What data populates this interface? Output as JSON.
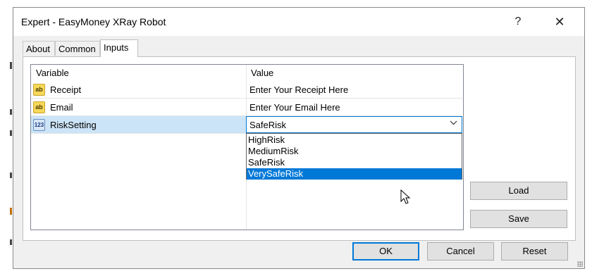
{
  "window": {
    "title": "Expert - EasyMoney XRay Robot",
    "help_glyph": "?",
    "close_glyph": "✕"
  },
  "tabs": [
    {
      "label": "About",
      "active": false
    },
    {
      "label": "Common",
      "active": false
    },
    {
      "label": "Inputs",
      "active": true
    }
  ],
  "grid": {
    "headers": {
      "variable": "Variable",
      "value": "Value"
    },
    "rows": [
      {
        "icon": "ab",
        "name": "Receipt",
        "value": "Enter Your Receipt Here"
      },
      {
        "icon": "ab",
        "name": "Email",
        "value": "Enter Your Email Here"
      },
      {
        "icon": "123",
        "name": "RiskSetting",
        "value": "SafeRisk"
      }
    ]
  },
  "dropdown": {
    "options": [
      "HighRisk",
      "MediumRisk",
      "SafeRisk",
      "VerySafeRisk"
    ],
    "highlighted": "VerySafeRisk"
  },
  "buttons": {
    "load": "Load",
    "save": "Save",
    "ok": "OK",
    "cancel": "Cancel",
    "reset": "Reset"
  },
  "colors": {
    "accent": "#0078d7",
    "selected_row": "#cce4f7"
  }
}
